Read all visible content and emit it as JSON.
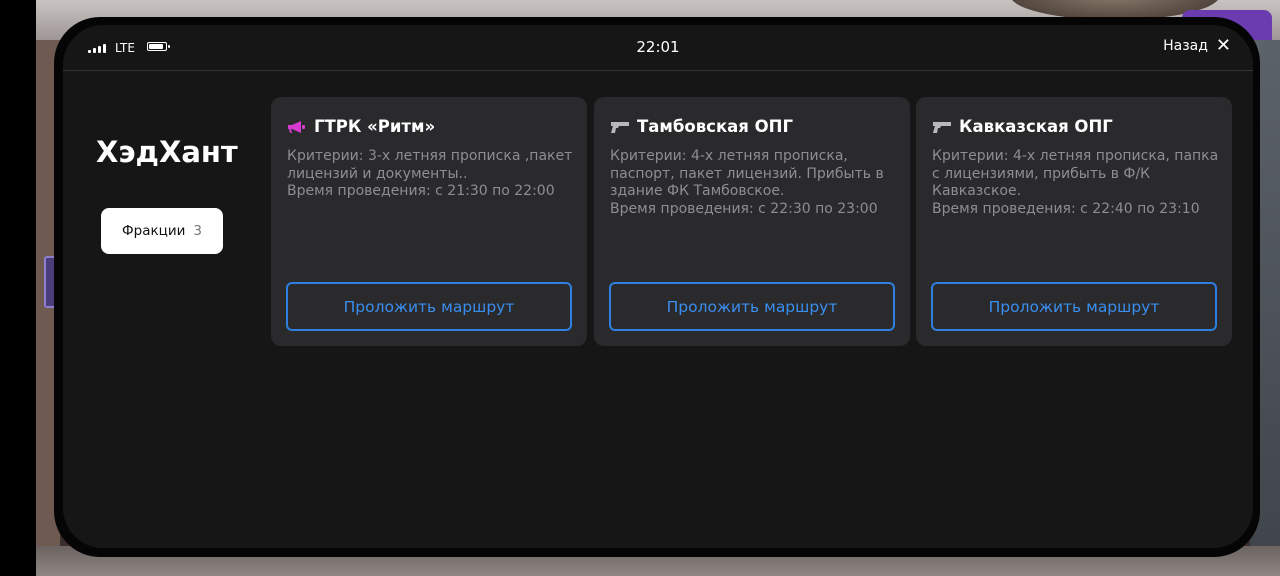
{
  "status_bar": {
    "network": "LTE",
    "time": "22:01",
    "back_label": "Назад",
    "close_glyph": "✕"
  },
  "app": {
    "title": "ХэдХант",
    "tab": {
      "label": "Фракции",
      "count": "3"
    }
  },
  "cards": [
    {
      "icon": "megaphone-icon",
      "icon_color": "#d63bd0",
      "title": "ГТРК «Ритм»",
      "criteria": "Критерии: 3-х летняя прописка ,пакет лицензий и документы..",
      "time": "Время проведения: с 21:30 по 22:00",
      "button": "Проложить маршрут"
    },
    {
      "icon": "gun-icon",
      "icon_color": "#b8b8bc",
      "title": "Тамбовская ОПГ",
      "criteria": "Критерии: 4-х летняя прописка, паспорт, пакет лицензий. Прибыть в здание ФК Тамбовское.",
      "time": "Время проведения: с 22:30 по 23:00",
      "button": "Проложить маршрут"
    },
    {
      "icon": "gun-icon",
      "icon_color": "#b8b8bc",
      "title": "Кавказская ОПГ",
      "criteria": "Критерии: 4-х летняя прописка, папка с лицензиями, прибыть в Ф/К Кавказское.",
      "time": "Время проведения: с 22:40 по 23:10",
      "button": "Проложить маршрут"
    }
  ],
  "colors": {
    "accent": "#2d7fe0",
    "card_bg": "#2a2a2c",
    "screen_bg": "#161617"
  }
}
